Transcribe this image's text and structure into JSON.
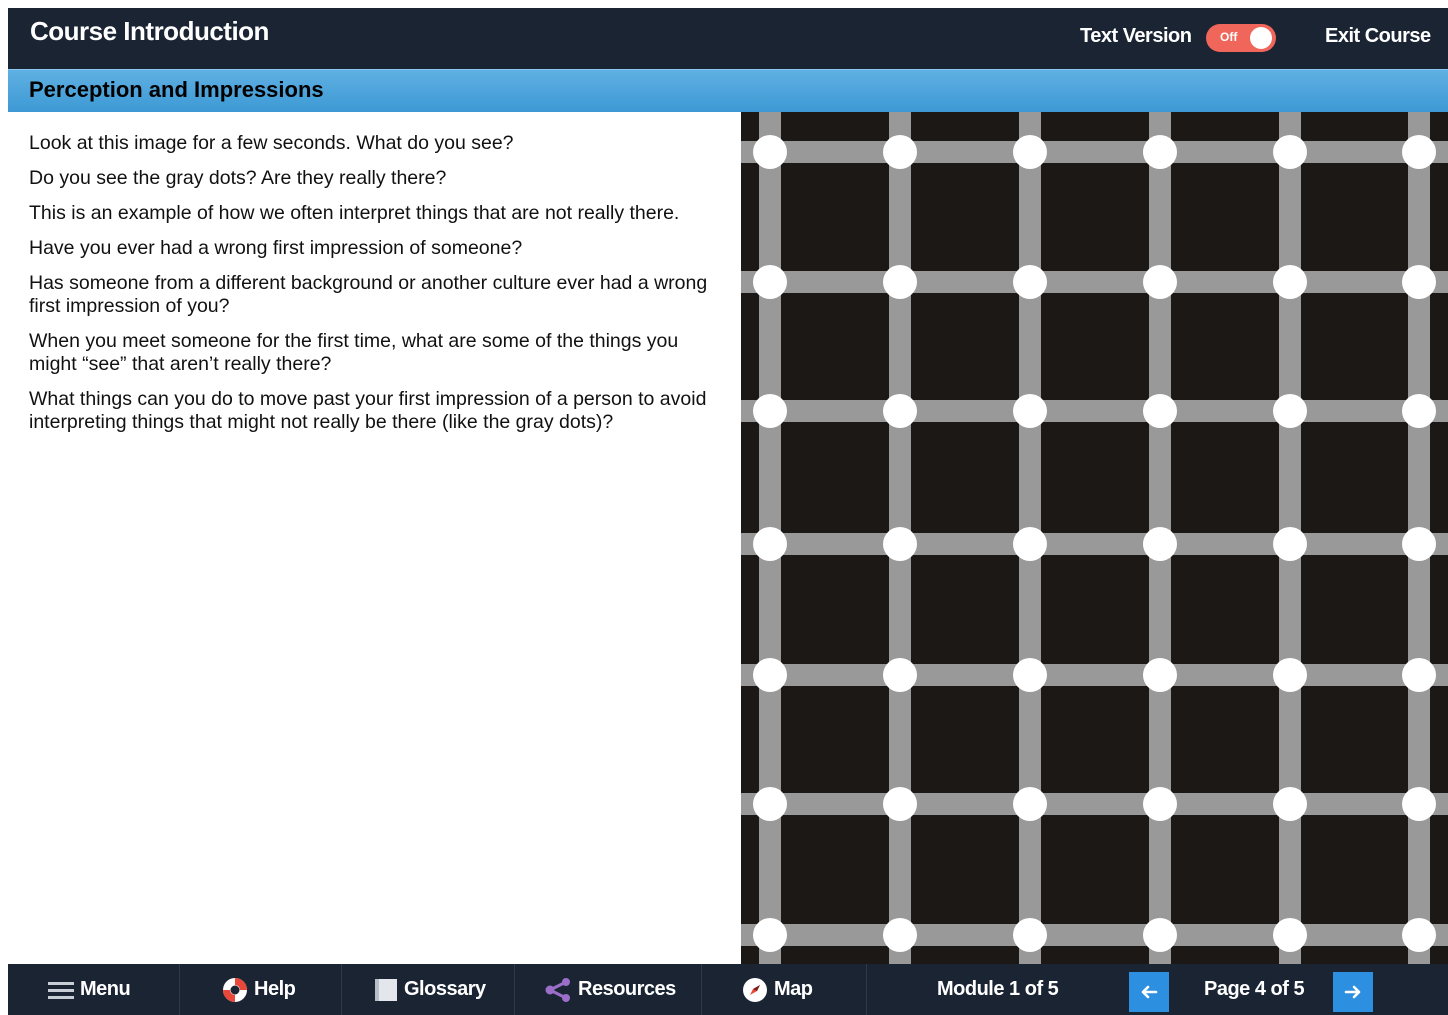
{
  "header": {
    "course_title": "Course Introduction",
    "text_version_label": "Text Version",
    "toggle_state": "Off",
    "exit_label": "Exit Course"
  },
  "page": {
    "title": "Perception and Impressions",
    "paragraphs": [
      "Look at this image for a few seconds. What do you see?",
      "Do you see the gray dots? Are they really there?",
      "This is an example of how we often interpret things that are not really there.",
      "Have you ever had a wrong first impression of someone?",
      "Has someone from a different background or another culture ever had a wrong first impression of you?",
      "When you meet someone for the first time, what are some of the things you might “see” that aren’t really there?",
      "What things can you do to move past your first impression of a person to avoid interpreting things that might not really be there (like the gray dots)?"
    ]
  },
  "footer": {
    "menu_label": "Menu",
    "help_label": "Help",
    "glossary_label": "Glossary",
    "resources_label": "Resources",
    "map_label": "Map",
    "module_status": "Module 1 of 5",
    "page_status": "Page 4 of 5"
  },
  "colors": {
    "header_bg": "#1a2433",
    "titlebar_blue": "#3d99d4",
    "toggle_off": "#f0665a",
    "nav_button": "#2d8fe0",
    "illusion_bg": "#1c1816",
    "grid_line": "#999999",
    "dot": "#ffffff"
  },
  "icons": {
    "menu": "hamburger-icon",
    "help": "lifebuoy-icon",
    "glossary": "book-icon",
    "resources": "share-icon",
    "map": "compass-icon",
    "prev": "arrow-left-icon",
    "next": "arrow-right-icon"
  }
}
